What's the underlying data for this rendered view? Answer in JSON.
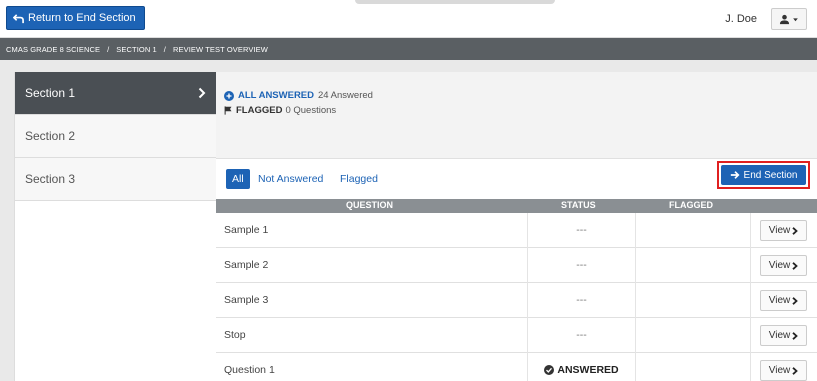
{
  "topbar": {
    "return_label": "Return to End Section",
    "user_name": "J. Doe"
  },
  "breadcrumb": [
    "CMAS GRADE 8 SCIENCE",
    "SECTION 1",
    "REVIEW TEST OVERVIEW"
  ],
  "sidebar": {
    "items": [
      {
        "label": "Section 1",
        "active": true
      },
      {
        "label": "Section 2",
        "active": false
      },
      {
        "label": "Section 3",
        "active": false
      }
    ]
  },
  "summary": {
    "all_answered_label": "ALL ANSWERED",
    "all_answered_count": "24 Answered",
    "flagged_label": "FLAGGED",
    "flagged_count": "0 Questions"
  },
  "filters": [
    "All",
    "Not Answered",
    "Flagged"
  ],
  "end_section_label": "End Section",
  "table": {
    "headers": [
      "QUESTION",
      "STATUS",
      "FLAGGED"
    ],
    "rows": [
      {
        "question": "Sample 1",
        "status": "---",
        "view": "View"
      },
      {
        "question": "Sample 2",
        "status": "---",
        "view": "View"
      },
      {
        "question": "Sample 3",
        "status": "---",
        "view": "View"
      },
      {
        "question": "Stop",
        "status": "---",
        "view": "View"
      },
      {
        "question": "Question 1",
        "status": "ANSWERED",
        "view": "View"
      }
    ]
  },
  "colors": {
    "primary": "#1d63b5",
    "highlight_border": "#e02020",
    "sidebar_active": "#4a4f54",
    "breadcrumb_bg": "#5a5f63"
  }
}
